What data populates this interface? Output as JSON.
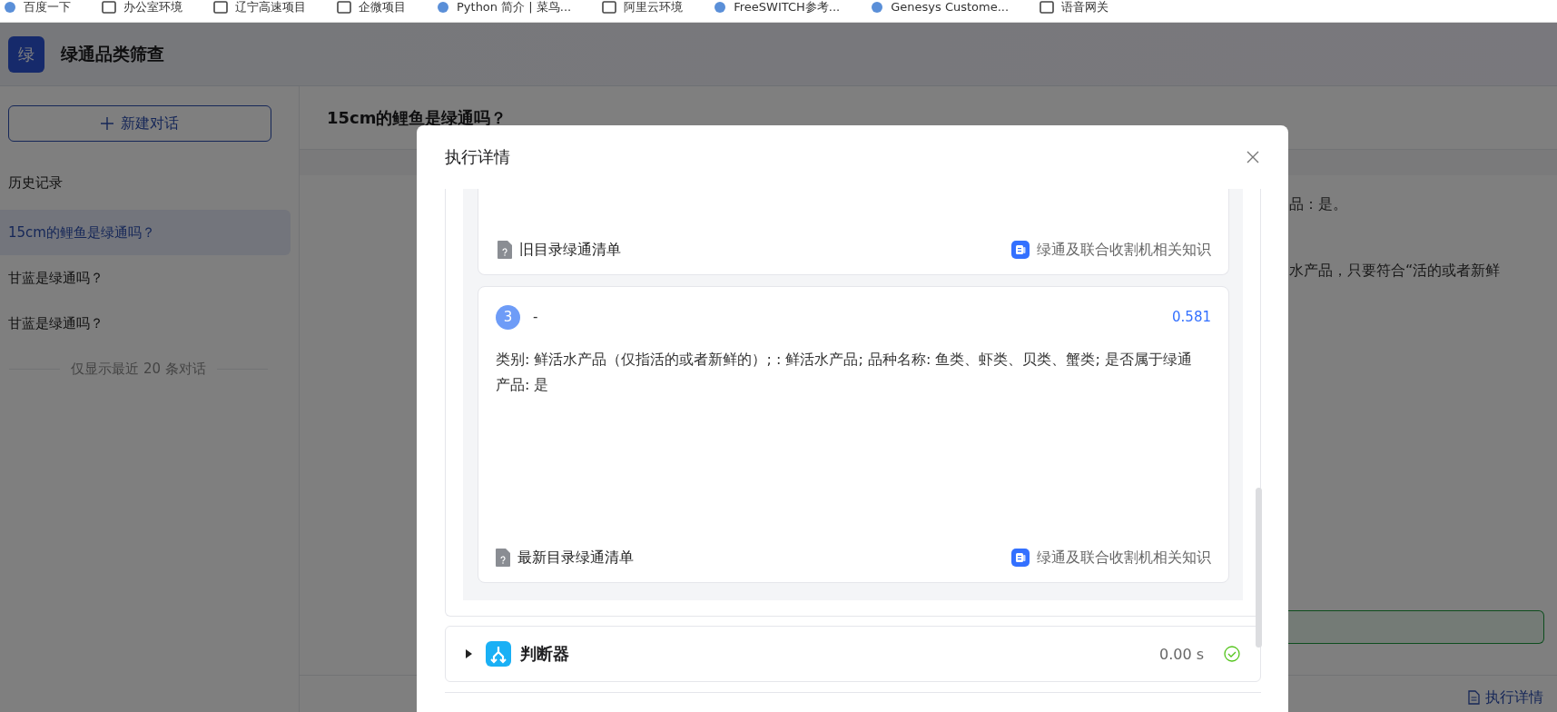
{
  "bookmarks": [
    {
      "label": "百度一下",
      "kind": "site"
    },
    {
      "label": "办公室环境",
      "kind": "folder"
    },
    {
      "label": "辽宁高速项目",
      "kind": "folder"
    },
    {
      "label": "企微项目",
      "kind": "folder"
    },
    {
      "label": "Python 简介 | 菜鸟...",
      "kind": "site"
    },
    {
      "label": "阿里云环境",
      "kind": "folder"
    },
    {
      "label": "FreeSWITCH参考...",
      "kind": "site"
    },
    {
      "label": "Genesys Custome...",
      "kind": "site"
    },
    {
      "label": "语音网关",
      "kind": "folder"
    }
  ],
  "app": {
    "logo": "绿",
    "title": "绿通品类筛查"
  },
  "sidebar": {
    "new_chat": "新建对话",
    "history_label": "历史记录",
    "items": [
      {
        "label": "15cm的鲤鱼是绿通吗？",
        "selected": true
      },
      {
        "label": "甘蓝是绿通吗？",
        "selected": false
      },
      {
        "label": "甘蓝是绿通吗？",
        "selected": false
      }
    ],
    "footer": "仅显示最近 20 条对话"
  },
  "main": {
    "title": "15cm的鲤鱼是绿通吗？",
    "answer_lines": [
      "品：是。",
      "水产品，只要符合“活的或者新鲜"
    ],
    "footer_link": "执行详情"
  },
  "modal": {
    "title": "执行详情",
    "results": [
      {
        "source": "旧目录绿通清单",
        "knowledge": "绿通及联合收割机相关知识"
      },
      {
        "index": "3",
        "title": "-",
        "score": "0.581",
        "content": "类别: 鲜活水产品（仅指活的或者新鲜的）; : 鲜活水产品; 品种名称: 鱼类、虾类、贝类、蟹类; 是否属于绿通产品: 是",
        "source": "最新目录绿通清单",
        "knowledge": "绿通及联合收割机相关知识"
      }
    ],
    "nodes": [
      {
        "name": "判断器",
        "duration": "0.00 s",
        "expanded": false,
        "succeeded": true
      }
    ]
  }
}
